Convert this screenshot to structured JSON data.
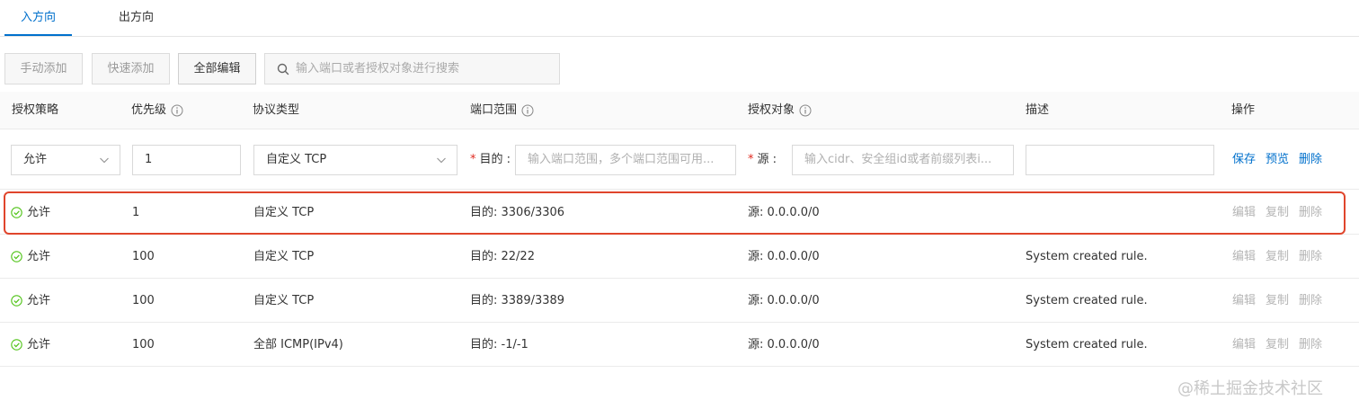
{
  "tabs": [
    {
      "label": "入方向",
      "active": true
    },
    {
      "label": "出方向",
      "active": false
    }
  ],
  "toolbar": {
    "manual_add": "手动添加",
    "quick_add": "快速添加",
    "edit_all": "全部编辑",
    "search_placeholder": "输入端口或者授权对象进行搜索"
  },
  "columns": [
    "授权策略",
    "优先级",
    "协议类型",
    "端口范围",
    "授权对象",
    "描述",
    "操作"
  ],
  "edit_row": {
    "policy": "允许",
    "priority": "1",
    "protocol": "自定义 TCP",
    "dest_label": "目的 :",
    "dest_placeholder": "输入端口范围，多个端口范围可用...",
    "src_label": "源 :",
    "src_placeholder": "输入cidr、安全组id或者前缀列表i...",
    "description": "",
    "actions": [
      "保存",
      "预览",
      "删除"
    ]
  },
  "rows": [
    {
      "policy": "允许",
      "priority": "1",
      "protocol": "自定义 TCP",
      "port": "目的: 3306/3306",
      "source": "源: 0.0.0.0/0",
      "description": "",
      "actions": [
        "编辑",
        "复制",
        "删除"
      ]
    },
    {
      "policy": "允许",
      "priority": "100",
      "protocol": "自定义 TCP",
      "port": "目的: 22/22",
      "source": "源: 0.0.0.0/0",
      "description": "System created rule.",
      "actions": [
        "编辑",
        "复制",
        "删除"
      ]
    },
    {
      "policy": "允许",
      "priority": "100",
      "protocol": "自定义 TCP",
      "port": "目的: 3389/3389",
      "source": "源: 0.0.0.0/0",
      "description": "System created rule.",
      "actions": [
        "编辑",
        "复制",
        "删除"
      ]
    },
    {
      "policy": "允许",
      "priority": "100",
      "protocol": "全部 ICMP(IPv4)",
      "port": "目的: -1/-1",
      "source": "源: 0.0.0.0/0",
      "description": "System created rule.",
      "actions": [
        "编辑",
        "复制",
        "删除"
      ]
    }
  ],
  "watermark": "@稀土掘金技术社区",
  "colors": {
    "accent": "#0070cc",
    "success": "#52c41a",
    "highlight": "#e0452c",
    "required": "#e0291f"
  }
}
